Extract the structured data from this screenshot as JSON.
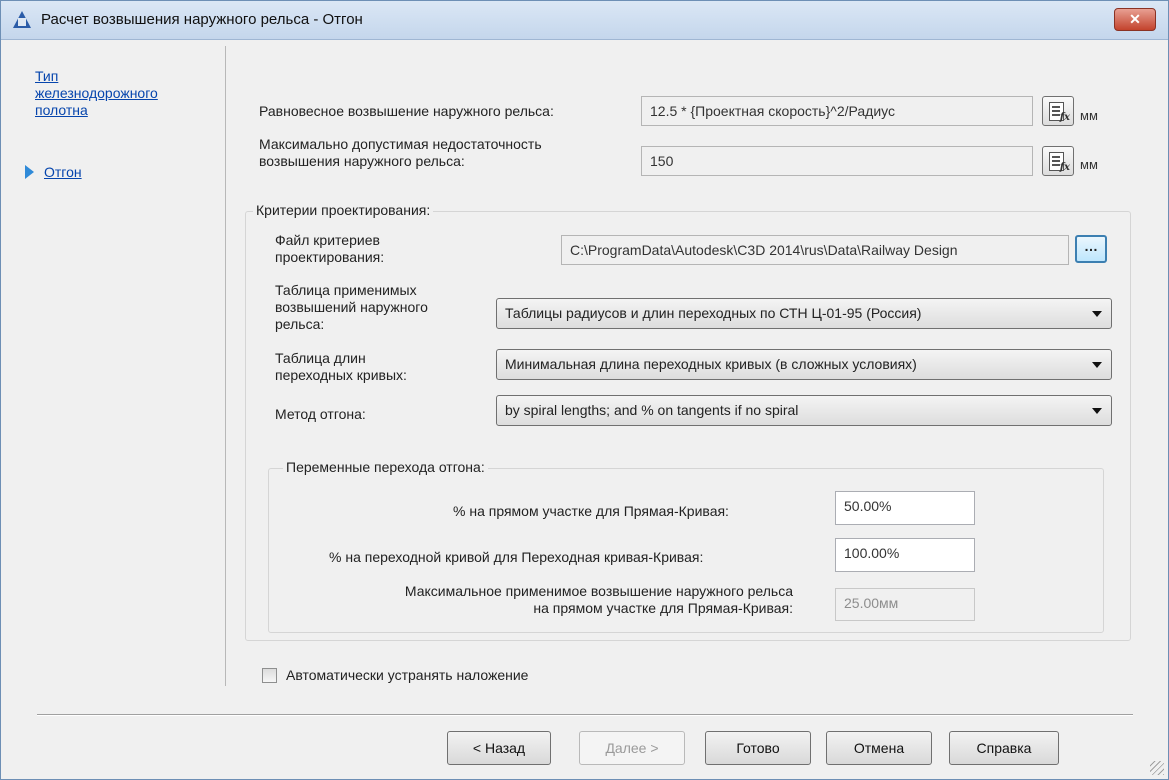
{
  "window": {
    "title": "Расчет возвышения наружного рельса - Отгон",
    "close_label": "✕"
  },
  "nav": {
    "items": [
      {
        "label_lines": [
          "Тип",
          "железнодорожного",
          "полотна"
        ]
      },
      {
        "label": "Отгон",
        "selected": true
      }
    ]
  },
  "top_fields": {
    "equilibrium_label": "Равновесное возвышение наружного рельса:",
    "equilibrium_value": "12.5 * {Проектная скорость}^2/Радиус",
    "equilibrium_unit": "мм",
    "deficiency_label_line1": "Максимально допустимая недостаточность",
    "deficiency_label_line2": "возвышения наружного рельса:",
    "deficiency_value": "150",
    "deficiency_unit": "мм"
  },
  "criteria": {
    "group_title": "Критерии проектирования:",
    "file_label_line1": "Файл критериев",
    "file_label_line2": "проектирования:",
    "file_value": "C:\\ProgramData\\Autodesk\\C3D 2014\\rus\\Data\\Railway Design",
    "browse_label": "…",
    "cant_table_label_line1": "Таблица применимых",
    "cant_table_label_line2": "возвышений наружного",
    "cant_table_label_line3": "рельса:",
    "cant_table_value": "Таблицы радиусов и длин переходных по СТН Ц-01-95 (Россия)",
    "spiral_table_label_line1": "Таблица длин",
    "spiral_table_label_line2": "переходных кривых:",
    "spiral_table_value": "Минимальная длина переходных кривых (в сложных условиях)",
    "method_label": "Метод отгона:",
    "method_value": "by spiral lengths; and % on tangents if no spiral"
  },
  "transition": {
    "group_title": "Переменные перехода отгона:",
    "tangent_label": "% на прямом участке для Прямая-Кривая:",
    "tangent_value": "50.00%",
    "spiral_label": "% на переходной кривой для Переходная кривая-Кривая:",
    "spiral_value": "100.00%",
    "max_label_line1": "Максимальное применимое возвышение наружного рельса",
    "max_label_line2": "на прямом участке для Прямая-Кривая:",
    "max_value": "25.00мм"
  },
  "auto_resolve": {
    "label": "Автоматически устранять наложение",
    "checked": false
  },
  "buttons": {
    "back": "< Назад",
    "next": "Далее >",
    "finish": "Готово",
    "cancel": "Отмена",
    "help": "Справка"
  }
}
